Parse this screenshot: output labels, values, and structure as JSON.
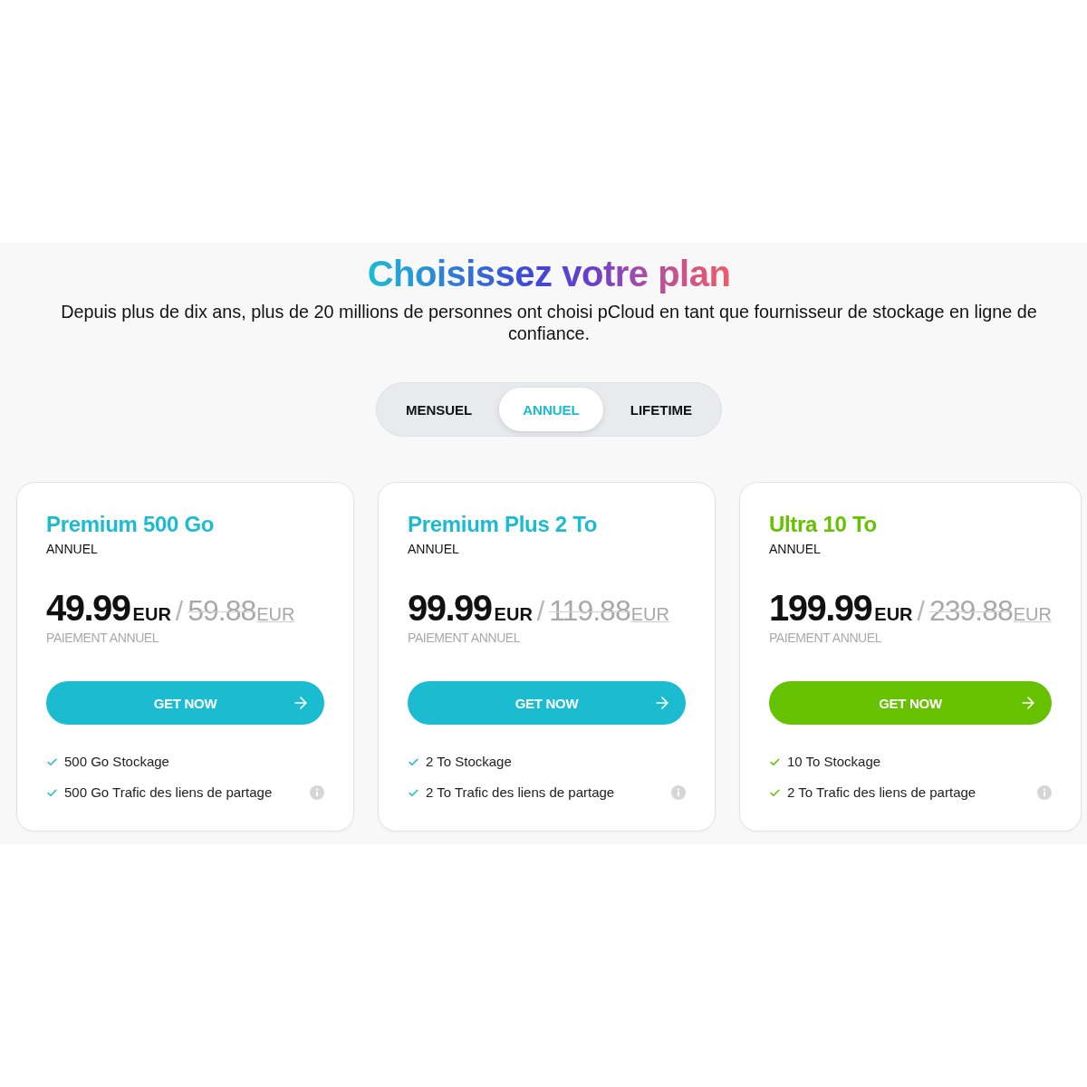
{
  "header": {
    "title": "Choisissez votre plan",
    "subtitle": "Depuis plus de dix ans, plus de 20 millions de personnes ont choisi pCloud en tant que fournisseur de stockage en ligne de confiance."
  },
  "billing_tabs": [
    {
      "label": "MENSUEL",
      "selected": false
    },
    {
      "label": "ANNUEL",
      "selected": true
    },
    {
      "label": "LIFETIME",
      "selected": false
    }
  ],
  "plans": [
    {
      "name": "Premium 500 Go",
      "color": "#1bbcd0",
      "period": "ANNUEL",
      "price": {
        "amount": "49.99",
        "currency": "EUR"
      },
      "separator": "/",
      "old_price": {
        "amount": "59.88",
        "currency": "EUR"
      },
      "billing_note": "PAIEMENT ANNUEL",
      "button": "GET NOW",
      "features": [
        {
          "text": "500 Go Stockage",
          "info": false
        },
        {
          "text": "500 Go Trafic des liens de partage",
          "info": true
        }
      ]
    },
    {
      "name": "Premium Plus 2 To",
      "color": "#1bbcd0",
      "period": "ANNUEL",
      "price": {
        "amount": "99.99",
        "currency": "EUR"
      },
      "separator": "/",
      "old_price": {
        "amount": "119.88",
        "currency": "EUR"
      },
      "billing_note": "PAIEMENT ANNUEL",
      "button": "GET NOW",
      "features": [
        {
          "text": "2 To Stockage",
          "info": false
        },
        {
          "text": "2 To Trafic des liens de partage",
          "info": true
        }
      ]
    },
    {
      "name": "Ultra 10 To",
      "color": "#66c100",
      "period": "ANNUEL",
      "price": {
        "amount": "199.99",
        "currency": "EUR"
      },
      "separator": "/",
      "old_price": {
        "amount": "239.88",
        "currency": "EUR"
      },
      "billing_note": "PAIEMENT ANNUEL",
      "button": "GET NOW",
      "features": [
        {
          "text": "10 To Stockage",
          "info": false
        },
        {
          "text": "2 To Trafic des liens de partage",
          "info": true
        }
      ]
    }
  ]
}
